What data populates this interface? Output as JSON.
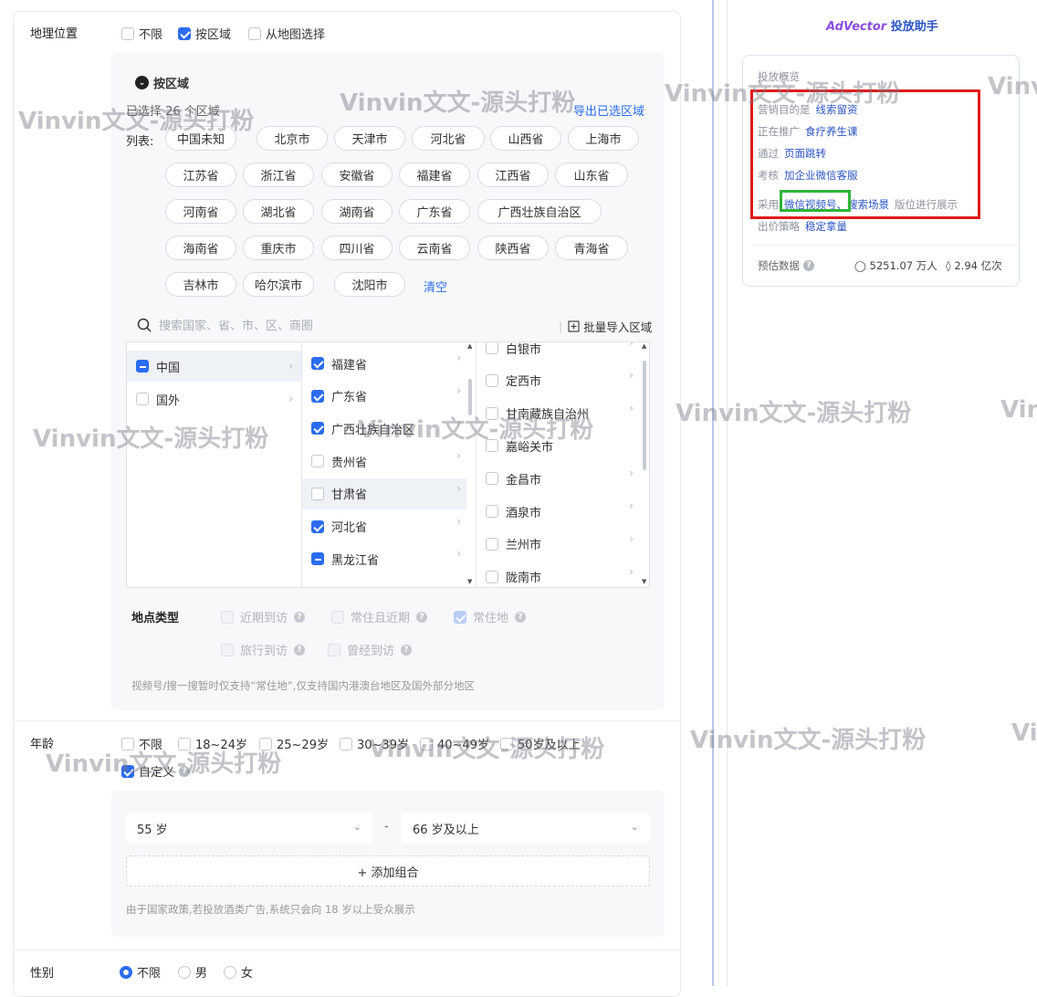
{
  "location": {
    "label": "地理位置",
    "options": [
      {
        "label": "不限",
        "checked": false
      },
      {
        "label": "按区域",
        "checked": true
      },
      {
        "label": "从地图选择",
        "checked": false
      }
    ],
    "section_title": "按区域",
    "selected_count_text": "已选择 26 个区域",
    "export_link": "导出已选区域",
    "list_label": "列表:",
    "tags": [
      "中国未知",
      "北京市",
      "天津市",
      "河北省",
      "山西省",
      "上海市",
      "江苏省",
      "浙江省",
      "安徽省",
      "福建省",
      "江西省",
      "山东省",
      "河南省",
      "湖北省",
      "湖南省",
      "广东省",
      "广西壮族自治区",
      "海南省",
      "重庆市",
      "四川省",
      "云南省",
      "陕西省",
      "青海省",
      "吉林市",
      "哈尔滨市",
      "沈阳市"
    ],
    "clear_link": "清空",
    "search_placeholder": "搜索国家、省、市、区、商圈",
    "batch_import": "批量导入区域",
    "tree_col1": [
      {
        "label": "中国",
        "state": "indet"
      },
      {
        "label": "国外",
        "state": "none"
      }
    ],
    "tree_col2": [
      {
        "label": "福建省",
        "state": "checked"
      },
      {
        "label": "广东省",
        "state": "checked"
      },
      {
        "label": "广西壮族自治区",
        "state": "checked"
      },
      {
        "label": "贵州省",
        "state": "none"
      },
      {
        "label": "甘肃省",
        "state": "none"
      },
      {
        "label": "河北省",
        "state": "checked"
      },
      {
        "label": "黑龙江省",
        "state": "indet"
      }
    ],
    "tree_col3": [
      {
        "label": "白银市"
      },
      {
        "label": "定西市"
      },
      {
        "label": "甘南藏族自治州"
      },
      {
        "label": "嘉峪关市"
      },
      {
        "label": "金昌市"
      },
      {
        "label": "酒泉市"
      },
      {
        "label": "兰州市"
      },
      {
        "label": "陇南市"
      }
    ],
    "place_type_label": "地点类型",
    "place_types": [
      {
        "label": "近期到访",
        "checked": false
      },
      {
        "label": "常住且近期",
        "checked": false
      },
      {
        "label": "常住地",
        "checked": true
      },
      {
        "label": "旅行到访",
        "checked": false
      },
      {
        "label": "曾经到访",
        "checked": false
      }
    ],
    "note": "视频号/搜一搜暂时仅支持“常住地”,仅支持国内港澳台地区及国外部分地区"
  },
  "age": {
    "label": "年龄",
    "options": [
      {
        "label": "不限",
        "checked": false
      },
      {
        "label": "18~24岁",
        "checked": false
      },
      {
        "label": "25~29岁",
        "checked": false
      },
      {
        "label": "30~39岁",
        "checked": false
      },
      {
        "label": "40~49岁",
        "checked": false
      },
      {
        "label": "50岁及以上",
        "checked": false
      }
    ],
    "custom_label": "自定义",
    "from_value": "55 岁",
    "dash": "-",
    "to_value": "66 岁及以上",
    "add_combo": "+ 添加组合",
    "note": "由于国家政策,若投放酒类广告,系统只会向 18 岁以上受众展示"
  },
  "gender": {
    "label": "性别",
    "options": [
      {
        "label": "不限",
        "checked": true
      },
      {
        "label": "男",
        "checked": false
      },
      {
        "label": "女",
        "checked": false
      }
    ]
  },
  "assistant": {
    "brand": "AdVector",
    "title": "投放助手",
    "summary_title": "投放概览",
    "lines": [
      {
        "key": "营销目的是",
        "value": "线索留资"
      },
      {
        "key": "正在推广",
        "value": "食疗养生课"
      },
      {
        "key": "通过",
        "value": "页面跳转"
      },
      {
        "key": "考核",
        "value": "加企业微信客服"
      }
    ],
    "placement_prefix": "采用",
    "placement_value1": "微信视频号、",
    "placement_value2": "搜索场景",
    "placement_suffix": "版位进行展示",
    "bid_key": "出价策略",
    "bid_value": "稳定拿量",
    "estimate_label": "预估数据",
    "estimate_users": "5251.07 万人",
    "estimate_views": "2.94 亿次"
  },
  "watermark_text": "Vinvin文文-源头打粉",
  "colors": {
    "accent": "#2b6cf0",
    "red_box": "#e01a1a",
    "green_box": "#2fb43a"
  }
}
